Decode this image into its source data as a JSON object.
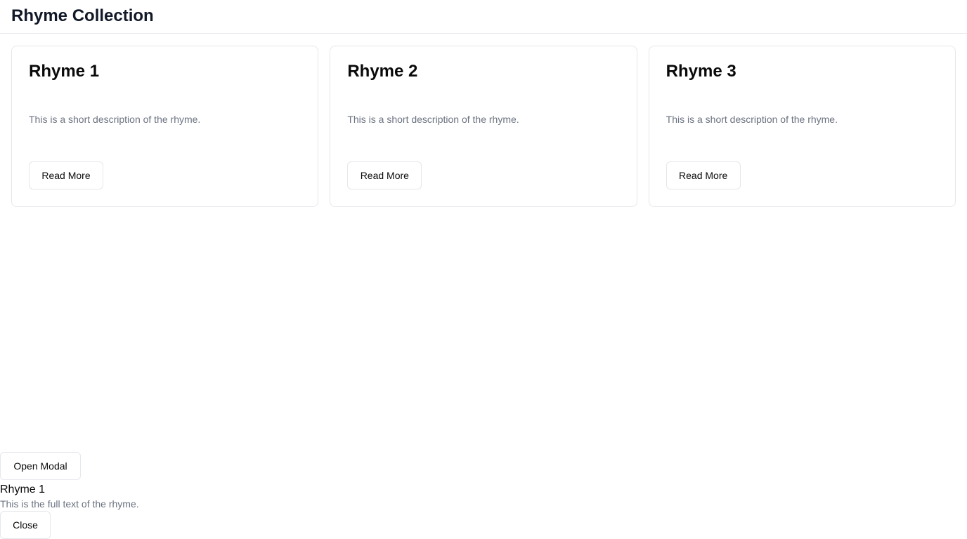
{
  "header": {
    "title": "Rhyme Collection"
  },
  "cards": [
    {
      "title": "Rhyme 1",
      "description": "This is a short description of the rhyme.",
      "button_label": "Read More"
    },
    {
      "title": "Rhyme 2",
      "description": "This is a short description of the rhyme.",
      "button_label": "Read More"
    },
    {
      "title": "Rhyme 3",
      "description": "This is a short description of the rhyme.",
      "button_label": "Read More"
    }
  ],
  "modal": {
    "open_label": "Open Modal",
    "title": "Rhyme 1",
    "text": "This is the full text of the rhyme.",
    "close_label": "Close"
  },
  "colors": {
    "text_primary": "#0a0a0a",
    "text_muted": "#6b7280",
    "border": "#e5e7eb",
    "background": "#ffffff"
  }
}
